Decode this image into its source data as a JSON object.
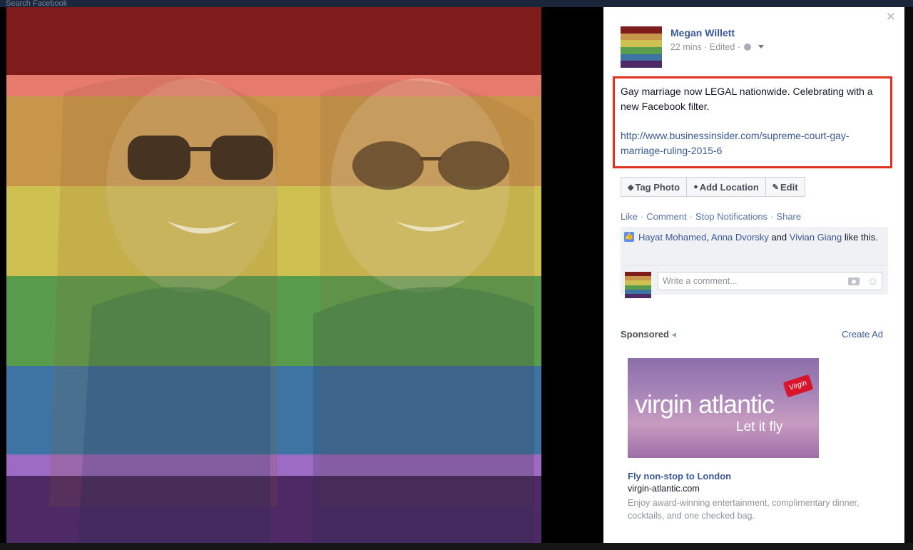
{
  "colors": {
    "brand_blue": "#3b5998",
    "highlight_red": "#e3301f",
    "rainbow": [
      "#7f1a19",
      "#e8715e",
      "#c99a3a",
      "#d7c64a",
      "#4f9a47",
      "#3f73a6",
      "#6b3d87",
      "#5a2f72"
    ]
  },
  "topbar": {
    "search_placeholder": "Search Facebook"
  },
  "post": {
    "author": "Megan Willett",
    "meta": "22 mins · Edited ·",
    "status_text": "Gay marriage now LEGAL nationwide. Celebrating with a new Facebook filter.",
    "link": "http://www.businessinsider.com/supreme-court-gay-marriage-ruling-2015-6"
  },
  "photo_buttons": {
    "tag_photo": "Tag Photo",
    "add_location": "Add Location",
    "edit": "Edit"
  },
  "actions": {
    "like": "Like",
    "comment": "Comment",
    "stop_notifications": "Stop Notifications",
    "share": "Share"
  },
  "likes": {
    "user1": "Hayat Mohamed",
    "user2": "Anna Dvorsky",
    "and": "and",
    "user3": "Vivian Giang",
    "suffix": "like this."
  },
  "comment_box": {
    "placeholder": "Write a comment..."
  },
  "sponsored": {
    "label": "Sponsored",
    "create_ad": "Create Ad",
    "ad_brand": "virgin atlantic",
    "ad_tagline": "Let it fly",
    "ad_logo_text": "Virgin",
    "ad_title": "Fly non-stop to London",
    "ad_domain": "virgin-atlantic.com",
    "ad_description": "Enjoy award-winning entertainment, complimentary dinner, cocktails, and one checked bag."
  }
}
